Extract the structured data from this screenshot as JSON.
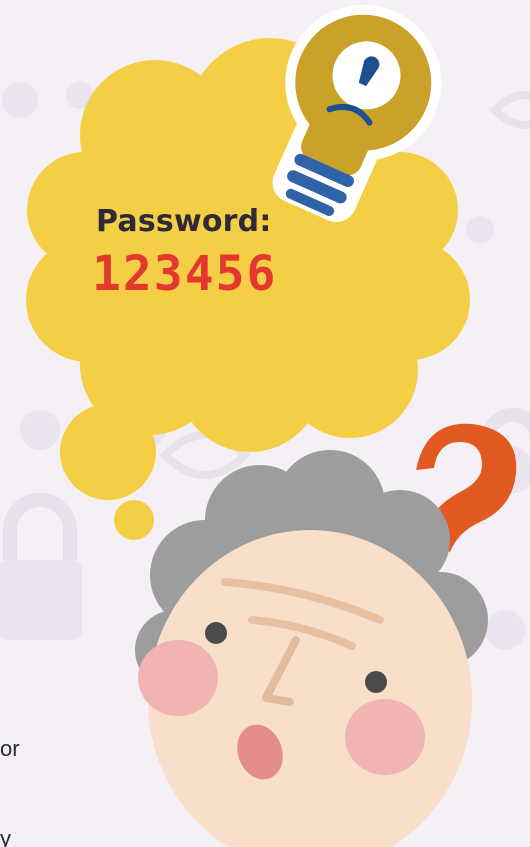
{
  "thought_bubble": {
    "label": "Password:",
    "value": "123456"
  },
  "edge_text": {
    "line1": "or",
    "line2": "y"
  },
  "colors": {
    "background": "#f4f0f6",
    "bubble": "#f4cf45",
    "password_value": "#e4372d",
    "password_label": "#2e2a38",
    "bulb": "#caa22a",
    "bulb_base": "#2e63a8",
    "question_mark": "#e05a22",
    "hair": "#9d9d9d",
    "skin": "#f8dfca"
  },
  "icons": [
    "lightbulb-icon",
    "question-mark-icon",
    "lock-icon",
    "eye-icon"
  ]
}
